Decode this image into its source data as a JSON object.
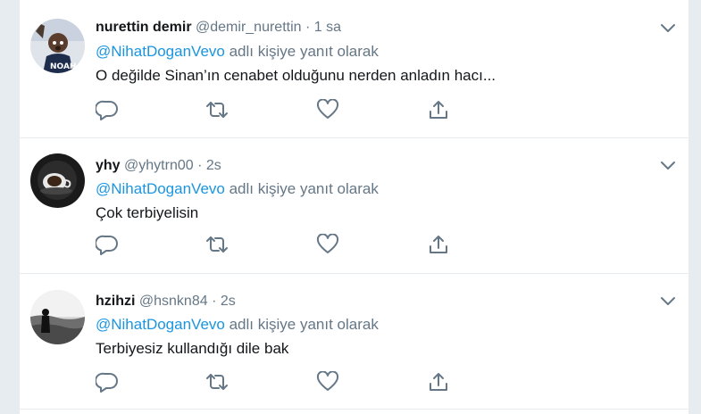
{
  "colors": {
    "link": "#1b95e0",
    "secondary": "#657786",
    "primary_text": "#14171a",
    "background": "#e6ecf0"
  },
  "icons": {
    "reply": "reply-icon",
    "retweet": "retweet-icon",
    "like": "heart-icon",
    "share": "share-icon",
    "menu": "chevron-down-icon"
  },
  "tweets": [
    {
      "name": "nurettin demir",
      "handle": "@demir_nurettin",
      "separator": "·",
      "time": "1 sa",
      "reply_mention": "@NihatDoganVevo",
      "reply_suffix": " adlı kişiye yanıt olarak",
      "text": "O değilde Sinan’ın cenabet olduğunu nerden anladın hacı..."
    },
    {
      "name": "yhy",
      "handle": "@yhytrn00",
      "separator": "·",
      "time": "2s",
      "reply_mention": "@NihatDoganVevo",
      "reply_suffix": " adlı kişiye yanıt olarak",
      "text": "Çok terbiyelisin"
    },
    {
      "name": "hzihzi",
      "handle": "@hsnkn84",
      "separator": "·",
      "time": "2s",
      "reply_mention": "@NihatDoganVevo",
      "reply_suffix": " adlı kişiye yanıt olarak",
      "text": "Terbiyesiz kullandığı dile bak"
    }
  ]
}
